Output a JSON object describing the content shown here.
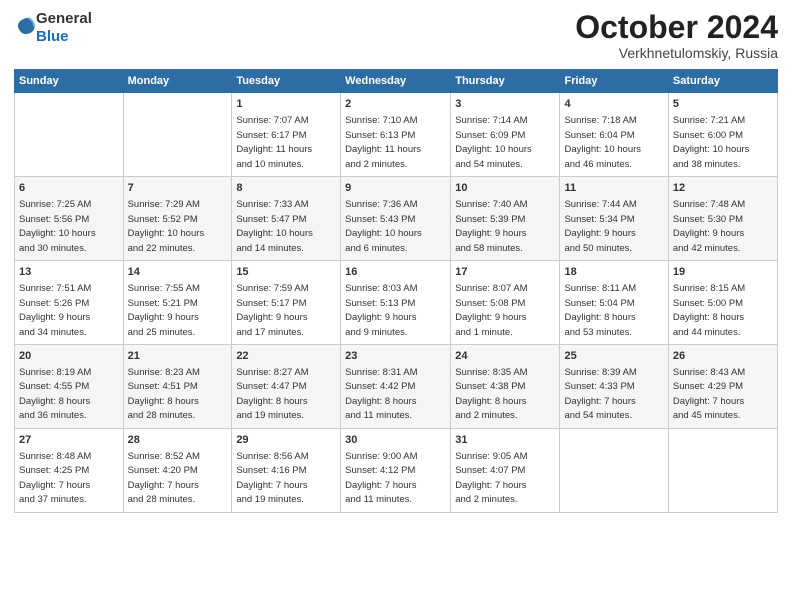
{
  "logo": {
    "line1": "General",
    "line2": "Blue"
  },
  "title": "October 2024",
  "location": "Verkhnetulomskiy, Russia",
  "weekdays": [
    "Sunday",
    "Monday",
    "Tuesday",
    "Wednesday",
    "Thursday",
    "Friday",
    "Saturday"
  ],
  "weeks": [
    [
      {
        "day": "",
        "info": ""
      },
      {
        "day": "",
        "info": ""
      },
      {
        "day": "1",
        "info": "Sunrise: 7:07 AM\nSunset: 6:17 PM\nDaylight: 11 hours\nand 10 minutes."
      },
      {
        "day": "2",
        "info": "Sunrise: 7:10 AM\nSunset: 6:13 PM\nDaylight: 11 hours\nand 2 minutes."
      },
      {
        "day": "3",
        "info": "Sunrise: 7:14 AM\nSunset: 6:09 PM\nDaylight: 10 hours\nand 54 minutes."
      },
      {
        "day": "4",
        "info": "Sunrise: 7:18 AM\nSunset: 6:04 PM\nDaylight: 10 hours\nand 46 minutes."
      },
      {
        "day": "5",
        "info": "Sunrise: 7:21 AM\nSunset: 6:00 PM\nDaylight: 10 hours\nand 38 minutes."
      }
    ],
    [
      {
        "day": "6",
        "info": "Sunrise: 7:25 AM\nSunset: 5:56 PM\nDaylight: 10 hours\nand 30 minutes."
      },
      {
        "day": "7",
        "info": "Sunrise: 7:29 AM\nSunset: 5:52 PM\nDaylight: 10 hours\nand 22 minutes."
      },
      {
        "day": "8",
        "info": "Sunrise: 7:33 AM\nSunset: 5:47 PM\nDaylight: 10 hours\nand 14 minutes."
      },
      {
        "day": "9",
        "info": "Sunrise: 7:36 AM\nSunset: 5:43 PM\nDaylight: 10 hours\nand 6 minutes."
      },
      {
        "day": "10",
        "info": "Sunrise: 7:40 AM\nSunset: 5:39 PM\nDaylight: 9 hours\nand 58 minutes."
      },
      {
        "day": "11",
        "info": "Sunrise: 7:44 AM\nSunset: 5:34 PM\nDaylight: 9 hours\nand 50 minutes."
      },
      {
        "day": "12",
        "info": "Sunrise: 7:48 AM\nSunset: 5:30 PM\nDaylight: 9 hours\nand 42 minutes."
      }
    ],
    [
      {
        "day": "13",
        "info": "Sunrise: 7:51 AM\nSunset: 5:26 PM\nDaylight: 9 hours\nand 34 minutes."
      },
      {
        "day": "14",
        "info": "Sunrise: 7:55 AM\nSunset: 5:21 PM\nDaylight: 9 hours\nand 25 minutes."
      },
      {
        "day": "15",
        "info": "Sunrise: 7:59 AM\nSunset: 5:17 PM\nDaylight: 9 hours\nand 17 minutes."
      },
      {
        "day": "16",
        "info": "Sunrise: 8:03 AM\nSunset: 5:13 PM\nDaylight: 9 hours\nand 9 minutes."
      },
      {
        "day": "17",
        "info": "Sunrise: 8:07 AM\nSunset: 5:08 PM\nDaylight: 9 hours\nand 1 minute."
      },
      {
        "day": "18",
        "info": "Sunrise: 8:11 AM\nSunset: 5:04 PM\nDaylight: 8 hours\nand 53 minutes."
      },
      {
        "day": "19",
        "info": "Sunrise: 8:15 AM\nSunset: 5:00 PM\nDaylight: 8 hours\nand 44 minutes."
      }
    ],
    [
      {
        "day": "20",
        "info": "Sunrise: 8:19 AM\nSunset: 4:55 PM\nDaylight: 8 hours\nand 36 minutes."
      },
      {
        "day": "21",
        "info": "Sunrise: 8:23 AM\nSunset: 4:51 PM\nDaylight: 8 hours\nand 28 minutes."
      },
      {
        "day": "22",
        "info": "Sunrise: 8:27 AM\nSunset: 4:47 PM\nDaylight: 8 hours\nand 19 minutes."
      },
      {
        "day": "23",
        "info": "Sunrise: 8:31 AM\nSunset: 4:42 PM\nDaylight: 8 hours\nand 11 minutes."
      },
      {
        "day": "24",
        "info": "Sunrise: 8:35 AM\nSunset: 4:38 PM\nDaylight: 8 hours\nand 2 minutes."
      },
      {
        "day": "25",
        "info": "Sunrise: 8:39 AM\nSunset: 4:33 PM\nDaylight: 7 hours\nand 54 minutes."
      },
      {
        "day": "26",
        "info": "Sunrise: 8:43 AM\nSunset: 4:29 PM\nDaylight: 7 hours\nand 45 minutes."
      }
    ],
    [
      {
        "day": "27",
        "info": "Sunrise: 8:48 AM\nSunset: 4:25 PM\nDaylight: 7 hours\nand 37 minutes."
      },
      {
        "day": "28",
        "info": "Sunrise: 8:52 AM\nSunset: 4:20 PM\nDaylight: 7 hours\nand 28 minutes."
      },
      {
        "day": "29",
        "info": "Sunrise: 8:56 AM\nSunset: 4:16 PM\nDaylight: 7 hours\nand 19 minutes."
      },
      {
        "day": "30",
        "info": "Sunrise: 9:00 AM\nSunset: 4:12 PM\nDaylight: 7 hours\nand 11 minutes."
      },
      {
        "day": "31",
        "info": "Sunrise: 9:05 AM\nSunset: 4:07 PM\nDaylight: 7 hours\nand 2 minutes."
      },
      {
        "day": "",
        "info": ""
      },
      {
        "day": "",
        "info": ""
      }
    ]
  ]
}
